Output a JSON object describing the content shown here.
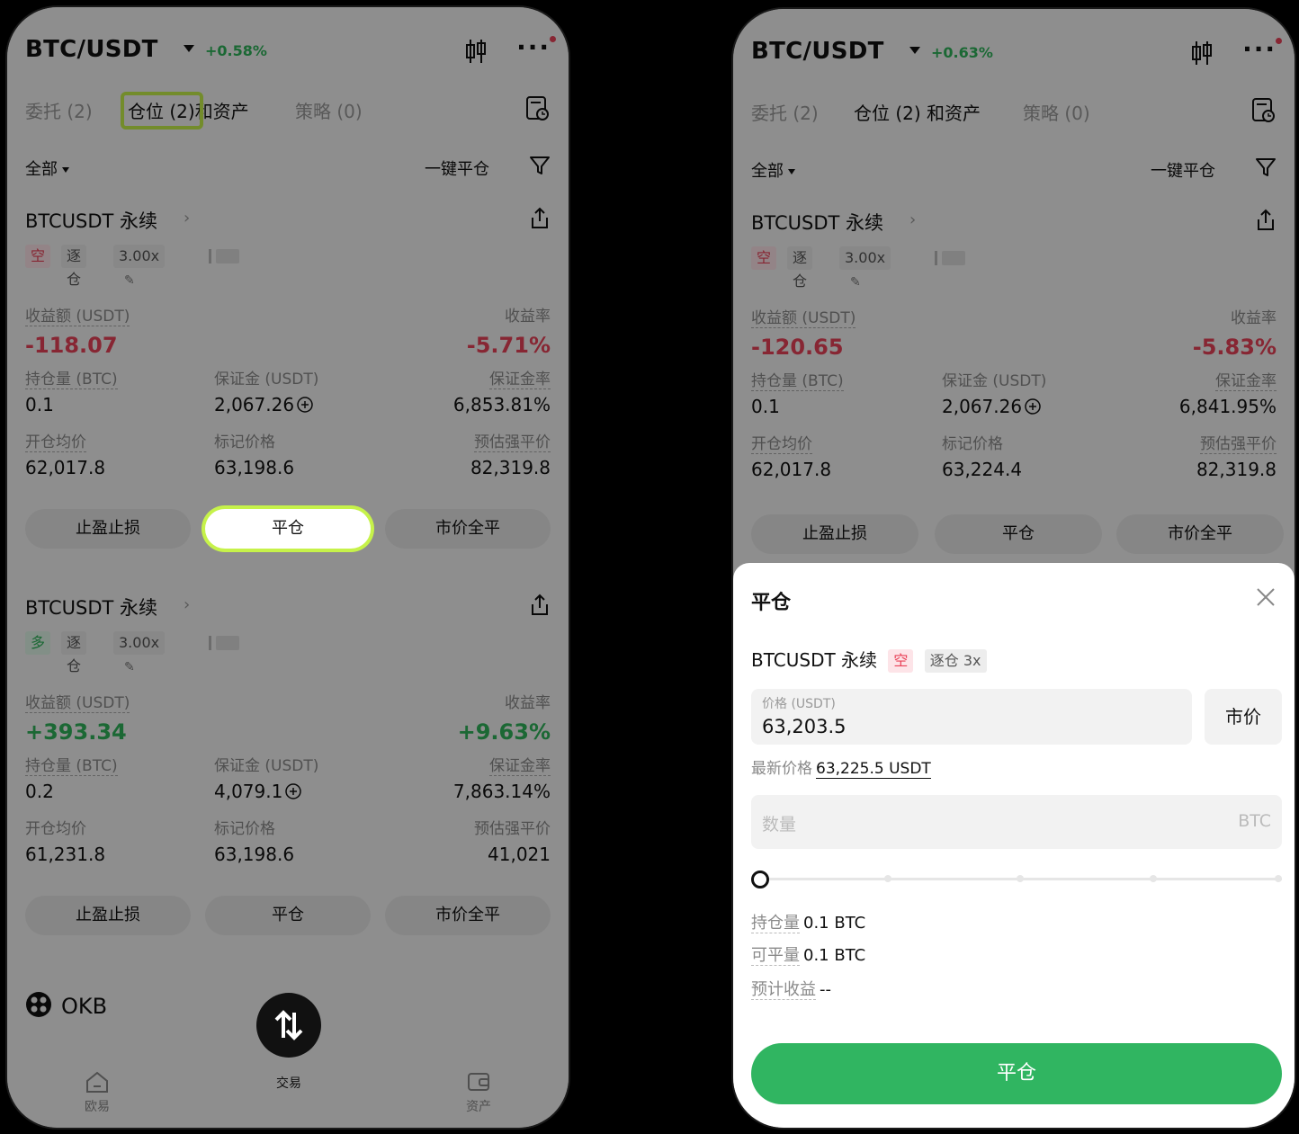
{
  "left": {
    "header": {
      "pair": "BTC/USDT",
      "change": "+0.58%"
    },
    "tabs": {
      "orders": "委托 (2)",
      "positions": "仓位 (2)",
      "assets": "和资产",
      "strategy": "策略 (0)"
    },
    "filter": {
      "all": "全部",
      "close_all": "一键平仓"
    },
    "positions": [
      {
        "title": "BTCUSDT 永续",
        "side": "空",
        "margin_mode": "逐仓",
        "leverage": "3.00x",
        "pnl_label": "收益额 (USDT)",
        "pnl": "-118.07",
        "roi_label": "收益率",
        "roi": "-5.71%",
        "size_label": "持仓量 (BTC)",
        "size": "0.1",
        "margin_label": "保证金 (USDT)",
        "margin": "2,067.26",
        "mratio_label": "保证金率",
        "mratio": "6,853.81%",
        "entry_label": "开仓均价",
        "entry": "62,017.8",
        "mark_label": "标记价格",
        "mark": "63,198.6",
        "liq_label": "预估强平价",
        "liq": "82,319.8",
        "btn_tpsl": "止盈止损",
        "btn_close": "平仓",
        "btn_market": "市价全平"
      },
      {
        "title": "BTCUSDT 永续",
        "side": "多",
        "margin_mode": "逐仓",
        "leverage": "3.00x",
        "pnl_label": "收益额 (USDT)",
        "pnl": "+393.34",
        "roi_label": "收益率",
        "roi": "+9.63%",
        "size_label": "持仓量 (BTC)",
        "size": "0.2",
        "margin_label": "保证金 (USDT)",
        "margin": "4,079.1",
        "mratio_label": "保证金率",
        "mratio": "7,863.14%",
        "entry_label": "开仓均价",
        "entry": "61,231.8",
        "mark_label": "标记价格",
        "mark": "63,198.6",
        "liq_label": "预估强平价",
        "liq": "41,021",
        "btn_tpsl": "止盈止损",
        "btn_close": "平仓",
        "btn_market": "市价全平"
      }
    ],
    "okb": {
      "name": "OKB"
    },
    "nav": {
      "left": "欧易",
      "center": "交易",
      "right": "资产"
    }
  },
  "right": {
    "header": {
      "pair": "BTC/USDT",
      "change": "+0.63%"
    },
    "tabs": {
      "orders": "委托 (2)",
      "positions": "仓位 (2) 和资产",
      "strategy": "策略 (0)"
    },
    "filter": {
      "all": "全部",
      "close_all": "一键平仓"
    },
    "position": {
      "title": "BTCUSDT 永续",
      "side": "空",
      "margin_mode": "逐仓",
      "leverage": "3.00x",
      "pnl_label": "收益额 (USDT)",
      "pnl": "-120.65",
      "roi_label": "收益率",
      "roi": "-5.83%",
      "size_label": "持仓量 (BTC)",
      "size": "0.1",
      "margin_label": "保证金 (USDT)",
      "margin": "2,067.26",
      "mratio_label": "保证金率",
      "mratio": "6,841.95%",
      "entry_label": "开仓均价",
      "entry": "62,017.8",
      "mark_label": "标记价格",
      "mark": "63,224.4",
      "liq_label": "预估强平价",
      "liq": "82,319.8",
      "btn_tpsl": "止盈止损",
      "btn_close": "平仓",
      "btn_market": "市价全平"
    },
    "sheet": {
      "title": "平仓",
      "instrument": "BTCUSDT 永续",
      "side": "空",
      "mode_leverage": "逐仓 3x",
      "price_placeholder": "价格 (USDT)",
      "price_value": "63,203.5",
      "market_button": "市价",
      "last_price_label": "最新价格",
      "last_price_value": "63,225.5 USDT",
      "qty_placeholder": "数量",
      "qty_unit": "BTC",
      "slider_percent": 0,
      "hold_label": "持仓量",
      "hold_value": "0.1 BTC",
      "closable_label": "可平量",
      "closable_value": "0.1 BTC",
      "est_label": "预计收益",
      "est_value": "--",
      "confirm": "平仓"
    }
  }
}
